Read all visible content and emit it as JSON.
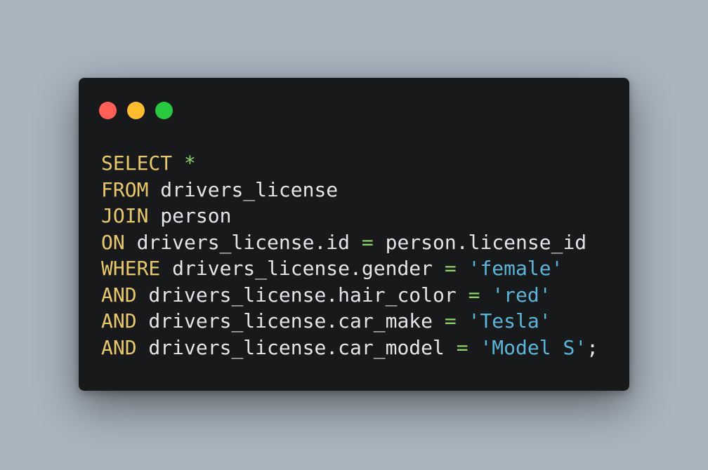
{
  "window": {
    "buttons": [
      {
        "name": "close-dot",
        "color": "#ff5f57"
      },
      {
        "name": "minimize-dot",
        "color": "#febc2e"
      },
      {
        "name": "maximize-dot",
        "color": "#28c840"
      }
    ]
  },
  "colors": {
    "keyword": "#e8c86d",
    "operator": "#8fd16a",
    "string": "#5bb6da",
    "identifier": "#e3e5e8"
  },
  "code": {
    "lines": [
      [
        {
          "t": "SELECT",
          "k": "keyword"
        },
        {
          "t": " ",
          "k": "identifier"
        },
        {
          "t": "*",
          "k": "operator"
        }
      ],
      [
        {
          "t": "FROM",
          "k": "keyword"
        },
        {
          "t": " drivers_license",
          "k": "identifier"
        }
      ],
      [
        {
          "t": "JOIN",
          "k": "keyword"
        },
        {
          "t": " person",
          "k": "identifier"
        }
      ],
      [
        {
          "t": "ON",
          "k": "keyword"
        },
        {
          "t": " drivers_license.id ",
          "k": "identifier"
        },
        {
          "t": "=",
          "k": "operator"
        },
        {
          "t": " person.license_id",
          "k": "identifier"
        }
      ],
      [
        {
          "t": "WHERE",
          "k": "keyword"
        },
        {
          "t": " drivers_license.gender ",
          "k": "identifier"
        },
        {
          "t": "=",
          "k": "operator"
        },
        {
          "t": " ",
          "k": "identifier"
        },
        {
          "t": "'female'",
          "k": "string"
        }
      ],
      [
        {
          "t": "AND",
          "k": "keyword"
        },
        {
          "t": " drivers_license.hair_color ",
          "k": "identifier"
        },
        {
          "t": "=",
          "k": "operator"
        },
        {
          "t": " ",
          "k": "identifier"
        },
        {
          "t": "'red'",
          "k": "string"
        }
      ],
      [
        {
          "t": "AND",
          "k": "keyword"
        },
        {
          "t": " drivers_license.car_make ",
          "k": "identifier"
        },
        {
          "t": "=",
          "k": "operator"
        },
        {
          "t": " ",
          "k": "identifier"
        },
        {
          "t": "'Tesla'",
          "k": "string"
        }
      ],
      [
        {
          "t": "AND",
          "k": "keyword"
        },
        {
          "t": " drivers_license.car_model ",
          "k": "identifier"
        },
        {
          "t": "=",
          "k": "operator"
        },
        {
          "t": " ",
          "k": "identifier"
        },
        {
          "t": "'Model S'",
          "k": "string"
        },
        {
          "t": ";",
          "k": "identifier"
        }
      ]
    ]
  }
}
